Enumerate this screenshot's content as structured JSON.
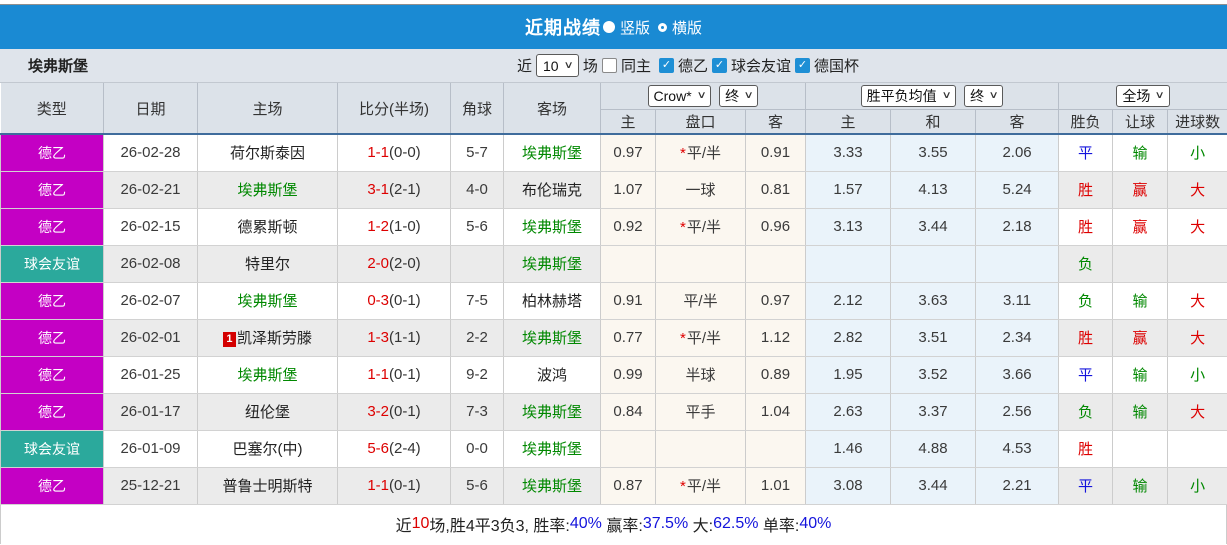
{
  "title_bar": {
    "title": "近期战绩",
    "vertical_label": "竖版",
    "horizontal_label": "横版",
    "vertical_selected": true
  },
  "filter_bar": {
    "team": "埃弗斯堡",
    "near_label": "近",
    "count_value": "10",
    "games_label": "场",
    "checkboxes": [
      {
        "label": "同主",
        "checked": false
      },
      {
        "label": "德乙",
        "checked": true
      },
      {
        "label": "球会友谊",
        "checked": true
      },
      {
        "label": "德国杯",
        "checked": true
      }
    ]
  },
  "table": {
    "headers": {
      "type": "类型",
      "date": "日期",
      "home": "主场",
      "score": "比分(半场)",
      "corner": "角球",
      "away": "客场",
      "crow_select": "Crow*",
      "crow_stage_select": "终",
      "avg_select": "胜平负均值",
      "avg_stage_select": "终",
      "scope_select": "全场",
      "sub": [
        "主",
        "盘口",
        "客",
        "主",
        "和",
        "客",
        "胜负",
        "让球",
        "进球数"
      ]
    },
    "type_colors": {
      "德乙": "#c400c4",
      "球会友谊": "#2ba99c"
    },
    "rows": [
      {
        "type": "德乙",
        "date": "26-02-28",
        "home": "荷尔斯泰因",
        "home_green": false,
        "home_badge": "",
        "score": "1-1",
        "half": "(0-0)",
        "corner": "5-7",
        "away": "埃弗斯堡",
        "away_green": true,
        "crow_home": "0.97",
        "handicap": "平/半",
        "handicap_star": true,
        "crow_away": "0.91",
        "avg_home": "3.33",
        "avg_draw": "3.55",
        "avg_away": "2.06",
        "result": "平",
        "result_color": "blue",
        "letgoal": "输",
        "letgoal_color": "green",
        "goals": "小",
        "goals_color": "green"
      },
      {
        "type": "德乙",
        "date": "26-02-21",
        "home": "埃弗斯堡",
        "home_green": true,
        "home_badge": "",
        "score": "3-1",
        "half": "(2-1)",
        "corner": "4-0",
        "away": "布伦瑞克",
        "away_green": false,
        "crow_home": "1.07",
        "handicap": "一球",
        "handicap_star": false,
        "crow_away": "0.81",
        "avg_home": "1.57",
        "avg_draw": "4.13",
        "avg_away": "5.24",
        "result": "胜",
        "result_color": "red",
        "letgoal": "赢",
        "letgoal_color": "red",
        "goals": "大",
        "goals_color": "red"
      },
      {
        "type": "德乙",
        "date": "26-02-15",
        "home": "德累斯顿",
        "home_green": false,
        "home_badge": "",
        "score": "1-2",
        "half": "(1-0)",
        "corner": "5-6",
        "away": "埃弗斯堡",
        "away_green": true,
        "crow_home": "0.92",
        "handicap": "平/半",
        "handicap_star": true,
        "crow_away": "0.96",
        "avg_home": "3.13",
        "avg_draw": "3.44",
        "avg_away": "2.18",
        "result": "胜",
        "result_color": "red",
        "letgoal": "赢",
        "letgoal_color": "red",
        "goals": "大",
        "goals_color": "red"
      },
      {
        "type": "球会友谊",
        "date": "26-02-08",
        "home": "特里尔",
        "home_green": false,
        "home_badge": "",
        "score": "2-0",
        "half": "(2-0)",
        "corner": "",
        "away": "埃弗斯堡",
        "away_green": true,
        "crow_home": "",
        "handicap": "",
        "handicap_star": false,
        "crow_away": "",
        "avg_home": "",
        "avg_draw": "",
        "avg_away": "",
        "result": "负",
        "result_color": "green",
        "letgoal": "",
        "letgoal_color": "green",
        "goals": "",
        "goals_color": "green"
      },
      {
        "type": "德乙",
        "date": "26-02-07",
        "home": "埃弗斯堡",
        "home_green": true,
        "home_badge": "",
        "score": "0-3",
        "half": "(0-1)",
        "corner": "7-5",
        "away": "柏林赫塔",
        "away_green": false,
        "crow_home": "0.91",
        "handicap": "平/半",
        "handicap_star": false,
        "crow_away": "0.97",
        "avg_home": "2.12",
        "avg_draw": "3.63",
        "avg_away": "3.11",
        "result": "负",
        "result_color": "green",
        "letgoal": "输",
        "letgoal_color": "green",
        "goals": "大",
        "goals_color": "red"
      },
      {
        "type": "德乙",
        "date": "26-02-01",
        "home": "凯泽斯劳滕",
        "home_green": false,
        "home_badge": "1",
        "score": "1-3",
        "half": "(1-1)",
        "corner": "2-2",
        "away": "埃弗斯堡",
        "away_green": true,
        "crow_home": "0.77",
        "handicap": "平/半",
        "handicap_star": true,
        "crow_away": "1.12",
        "avg_home": "2.82",
        "avg_draw": "3.51",
        "avg_away": "2.34",
        "result": "胜",
        "result_color": "red",
        "letgoal": "赢",
        "letgoal_color": "red",
        "goals": "大",
        "goals_color": "red"
      },
      {
        "type": "德乙",
        "date": "26-01-25",
        "home": "埃弗斯堡",
        "home_green": true,
        "home_badge": "",
        "score": "1-1",
        "half": "(0-1)",
        "corner": "9-2",
        "away": "波鸿",
        "away_green": false,
        "crow_home": "0.99",
        "handicap": "半球",
        "handicap_star": false,
        "crow_away": "0.89",
        "avg_home": "1.95",
        "avg_draw": "3.52",
        "avg_away": "3.66",
        "result": "平",
        "result_color": "blue",
        "letgoal": "输",
        "letgoal_color": "green",
        "goals": "小",
        "goals_color": "green"
      },
      {
        "type": "德乙",
        "date": "26-01-17",
        "home": "纽伦堡",
        "home_green": false,
        "home_badge": "",
        "score": "3-2",
        "half": "(0-1)",
        "corner": "7-3",
        "away": "埃弗斯堡",
        "away_green": true,
        "crow_home": "0.84",
        "handicap": "平手",
        "handicap_star": false,
        "crow_away": "1.04",
        "avg_home": "2.63",
        "avg_draw": "3.37",
        "avg_away": "2.56",
        "result": "负",
        "result_color": "green",
        "letgoal": "输",
        "letgoal_color": "green",
        "goals": "大",
        "goals_color": "red"
      },
      {
        "type": "球会友谊",
        "date": "26-01-09",
        "home": "巴塞尔(中)",
        "home_green": false,
        "home_badge": "",
        "score": "5-6",
        "half": "(2-4)",
        "corner": "0-0",
        "away": "埃弗斯堡",
        "away_green": true,
        "crow_home": "",
        "handicap": "",
        "handicap_star": false,
        "crow_away": "",
        "avg_home": "1.46",
        "avg_draw": "4.88",
        "avg_away": "4.53",
        "result": "胜",
        "result_color": "red",
        "letgoal": "",
        "letgoal_color": "red",
        "goals": "",
        "goals_color": "red"
      },
      {
        "type": "德乙",
        "date": "25-12-21",
        "home": "普鲁士明斯特",
        "home_green": false,
        "home_badge": "",
        "score": "1-1",
        "half": "(0-1)",
        "corner": "5-6",
        "away": "埃弗斯堡",
        "away_green": true,
        "crow_home": "0.87",
        "handicap": "平/半",
        "handicap_star": true,
        "crow_away": "1.01",
        "avg_home": "3.08",
        "avg_draw": "3.44",
        "avg_away": "2.21",
        "result": "平",
        "result_color": "blue",
        "letgoal": "输",
        "letgoal_color": "green",
        "goals": "小",
        "goals_color": "green"
      }
    ]
  },
  "summary": {
    "segments": [
      {
        "text": "近",
        "color": "black"
      },
      {
        "text": "10",
        "color": "red"
      },
      {
        "text": "场,胜4平3负3, 胜率:",
        "color": "black"
      },
      {
        "text": "40%",
        "color": "blue"
      },
      {
        "text": " 赢率:",
        "color": "black"
      },
      {
        "text": "37.5%",
        "color": "blue"
      },
      {
        "text": " 大:",
        "color": "black"
      },
      {
        "text": "62.5%",
        "color": "blue"
      },
      {
        "text": " 单率:",
        "color": "black"
      },
      {
        "text": "40%",
        "color": "blue"
      }
    ]
  }
}
